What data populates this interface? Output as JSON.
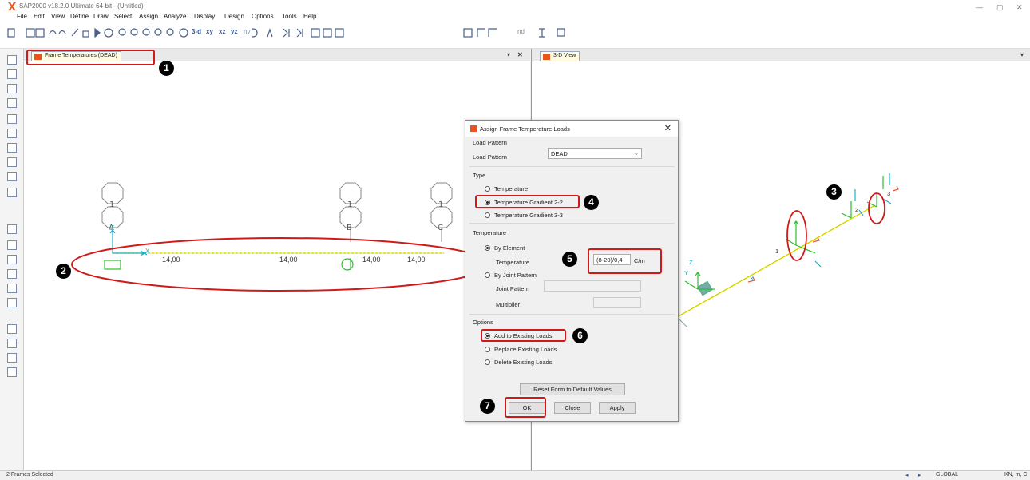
{
  "window": {
    "title": "SAP2000 v18.2.0 Ultimate 64-bit - (Untitled)"
  },
  "menu": [
    "File",
    "Edit",
    "View",
    "Define",
    "Draw",
    "Select",
    "Assign",
    "Analyze",
    "Display",
    "Design",
    "Options",
    "Tools",
    "Help"
  ],
  "toolbar": {
    "view_3d": "3-d",
    "view_xy": "xy",
    "view_xz": "xz",
    "view_yz": "yz",
    "view_nv": "nv",
    "view_nd": "nd"
  },
  "left_panel": {
    "tab_label": "Frame Temperatures (DEAD)",
    "grid_top_labels": [
      "1",
      "1",
      "1"
    ],
    "grid_labels": [
      "A",
      "B",
      "C"
    ],
    "axis_label": "Z",
    "axis_x_label": "X",
    "load_values": [
      "14,00",
      "14,00",
      "14,00",
      "14,00"
    ],
    "load_color": "#e8e800"
  },
  "right_panel": {
    "tab_label": "3-D View",
    "frame_labels": [
      "1",
      "2",
      "3"
    ],
    "axis_z": "Z",
    "axis_y": "Y",
    "axis_x": "X"
  },
  "dialog": {
    "title": "Assign Frame Temperature Loads",
    "load_pattern_group": "Load Pattern",
    "load_pattern_label": "Load Pattern",
    "load_pattern_value": "DEAD",
    "type_group": "Type",
    "type_options": [
      "Temperature",
      "Temperature Gradient 2-2",
      "Temperature Gradient 3-3"
    ],
    "type_selected": 1,
    "temperature_group": "Temperature",
    "by_element_label": "By Element",
    "temperature_label": "Temperature",
    "temperature_value": "(8-20)/0,4",
    "temperature_unit": "C/m",
    "by_joint_label": "By Joint Pattern",
    "joint_pattern_label": "Joint Pattern",
    "multiplier_label": "Multiplier",
    "options_group": "Options",
    "options": [
      "Add to Existing Loads",
      "Replace Existing Loads",
      "Delete Existing Loads"
    ],
    "options_selected": 0,
    "reset_label": "Reset Form to Default Values",
    "ok_label": "OK",
    "close_label": "Close",
    "apply_label": "Apply"
  },
  "callouts": [
    "1",
    "2",
    "3",
    "4",
    "5",
    "6",
    "7"
  ],
  "status": {
    "left": "2 Frames Selected",
    "coord": "GLOBAL",
    "units": "KN, m, C"
  },
  "colors": {
    "highlight": "#d01a1a",
    "accent": "#e8541a",
    "grid_line": "#e8e800",
    "cyan": "#1ab0c8"
  }
}
